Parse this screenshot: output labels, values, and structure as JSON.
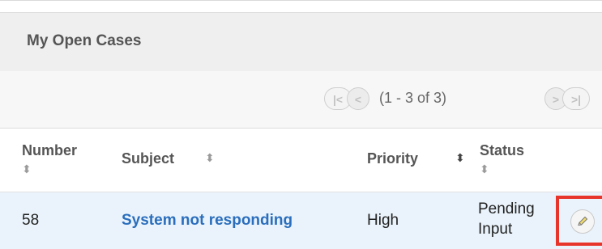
{
  "dashlet": {
    "title": "My Open Cases"
  },
  "pagination": {
    "range": "(1 - 3 of 3)",
    "first_glyph": "|<",
    "prev_glyph": "<",
    "next_glyph": ">",
    "last_glyph": ">|"
  },
  "columns": [
    {
      "label": "Number"
    },
    {
      "label": "Subject"
    },
    {
      "label": "Priority"
    },
    {
      "label": "Status"
    }
  ],
  "rows": [
    {
      "number": "58",
      "subject": "System not responding",
      "priority": "High",
      "status_line1": "Pending",
      "status_line2": "Input"
    }
  ],
  "icons": {
    "sort": "sort-icon",
    "edit": "pencil-icon"
  },
  "colors": {
    "link": "#2a6ebd",
    "row_highlight": "#eaf3fb",
    "edit_highlight": "#e8352b"
  }
}
